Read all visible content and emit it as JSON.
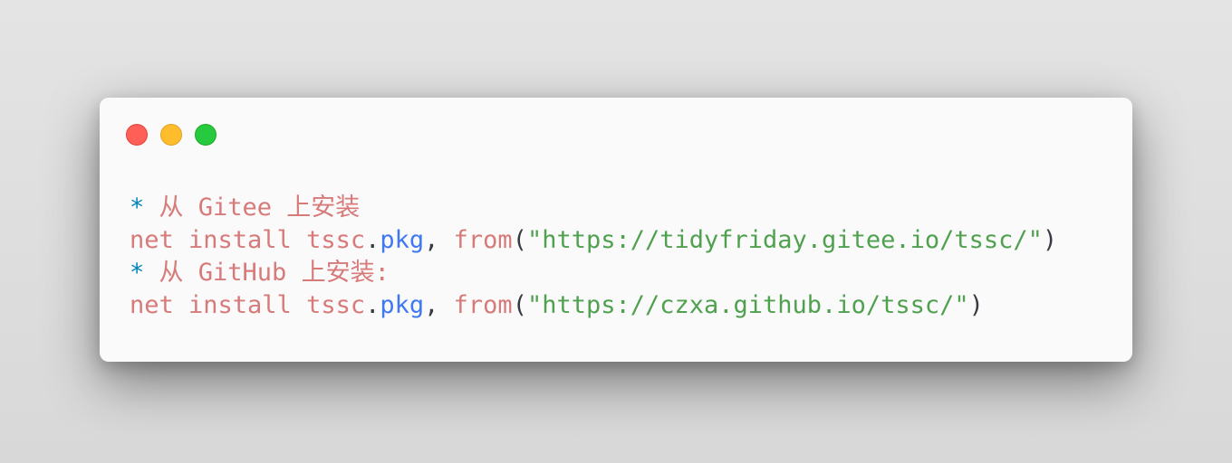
{
  "window": {
    "controls": [
      "close",
      "minimize",
      "maximize"
    ]
  },
  "code": {
    "lines": [
      {
        "star": "*",
        "comment": " 从 Gitee 上安装"
      },
      {
        "cmd": "net install tssc",
        "dot": ".",
        "prop": "pkg",
        "comma": ", ",
        "fn": "from",
        "open": "(",
        "str": "\"https://tidyfriday.gitee.io/tssc/\"",
        "close": ")"
      },
      {
        "star": "*",
        "comment": " 从 GitHub 上安装:"
      },
      {
        "cmd": "net install tssc",
        "dot": ".",
        "prop": "pkg",
        "comma": ", ",
        "fn": "from",
        "open": "(",
        "str": "\"https://czxa.github.io/tssc/\"",
        "close": ")"
      }
    ]
  },
  "colors": {
    "comment_star": "#0184bc",
    "comment_text": "#d77a7a",
    "identifier": "#d77a7a",
    "property": "#4078f2",
    "string": "#50a14f",
    "punctuation": "#383a42",
    "window_bg": "#fafafa"
  }
}
